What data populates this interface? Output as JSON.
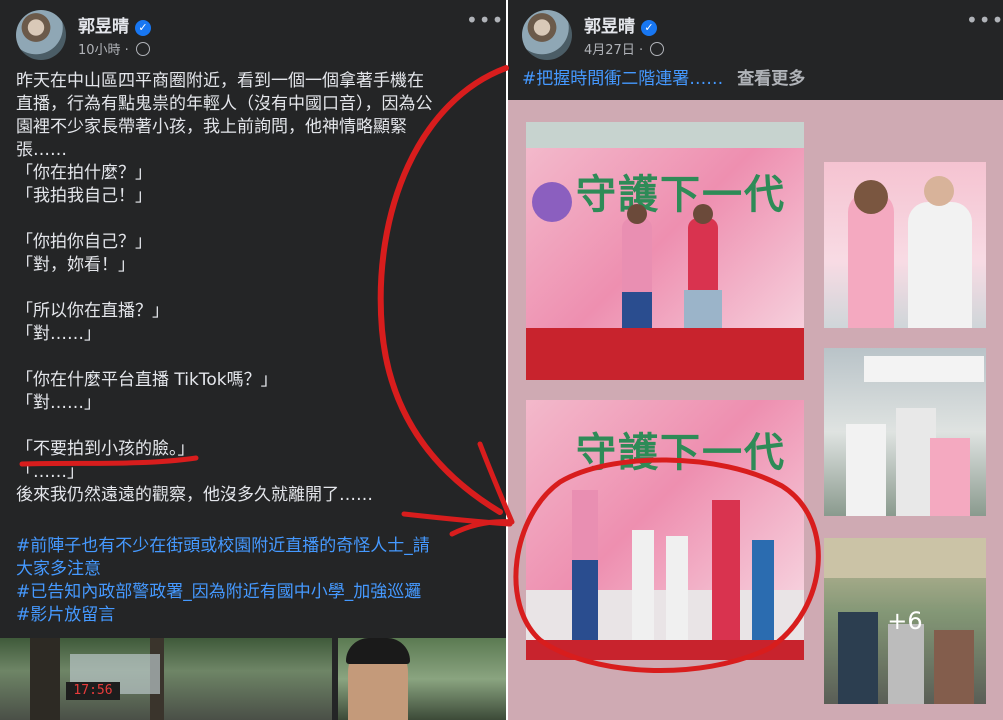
{
  "left_post": {
    "author": "郭昱晴",
    "time": "10小時",
    "lines": [
      "昨天在中山區四平商圈附近，看到一個一個拿著手機在",
      "直播，行為有點鬼祟的年輕人（沒有中國口音），因為公",
      "園裡不少家長帶著小孩，我上前詢問，他神情略顯緊",
      "張……",
      "「你在拍什麼？」",
      "「我拍我自己！」",
      "",
      "「你拍你自己？」",
      "「對，妳看！」",
      "",
      "「所以你在直播？」",
      "「對……」",
      "",
      "「你在什麼平台直播 TikTok嗎？」",
      "「對……」",
      "",
      "「不要拍到小孩的臉。」",
      "「……」",
      "後來我仍然遠遠的觀察，他沒多久就離開了……"
    ],
    "hashtags": [
      "#前陣子也有不少在街頭或校園附近直播的奇怪人士_請",
      "大家多注意",
      "#已告知內政部警政署_因為附近有國中小學_加強巡邏",
      "#影片放留言"
    ],
    "strip_clock": "17:56"
  },
  "right_post": {
    "author": "郭昱晴",
    "time": "4月27日",
    "caption": "#把握時間衝二階連署……",
    "see_more": "查看更多",
    "banner_text": "守護下一代",
    "more_count": "+6"
  },
  "colors": {
    "panel_bg": "#242526",
    "text": "#e4e6eb",
    "meta": "#b0b3b8",
    "link": "#4599ff",
    "annotation_red": "#d81d1d",
    "pink_bg": "#cfaab3"
  }
}
